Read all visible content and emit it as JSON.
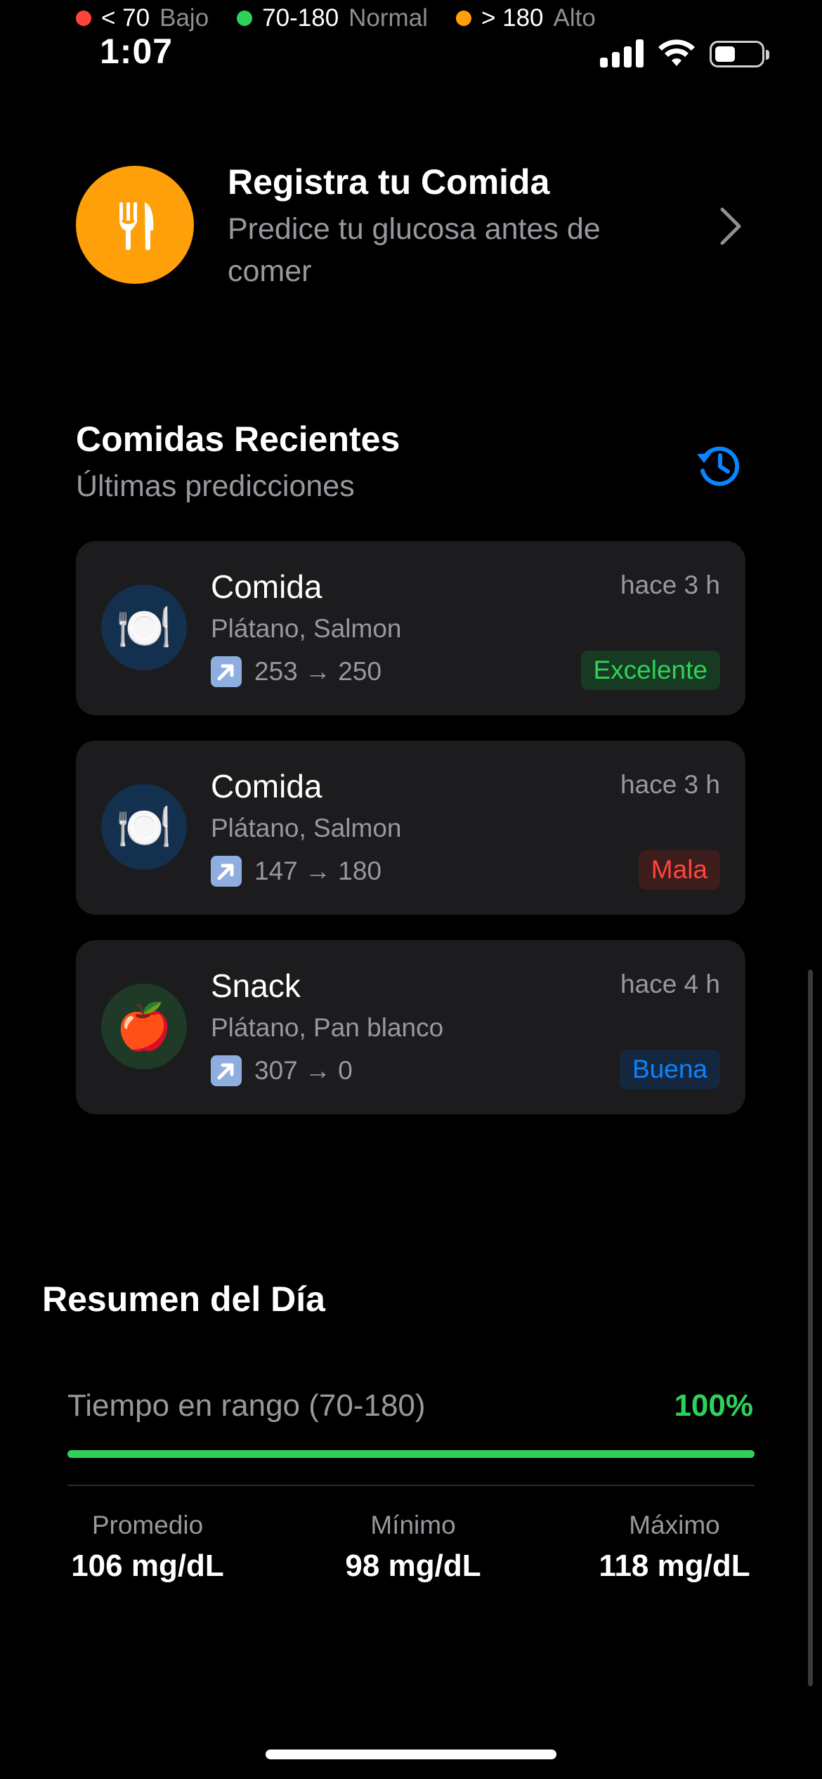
{
  "legend": [
    {
      "value": "< 70",
      "label": "Bajo",
      "color": "#ff453a"
    },
    {
      "value": "70-180",
      "label": "Normal",
      "color": "#30d158"
    },
    {
      "value": "> 180",
      "label": "Alto",
      "color": "#ff9f0a"
    }
  ],
  "status_bar": {
    "time": "1:07",
    "signal_icon": "cellular-signal-icon",
    "wifi_icon": "wifi-icon",
    "battery_icon": "battery-icon"
  },
  "register_meal": {
    "title": "Registra tu Comida",
    "subtitle": "Predice tu glucosa antes de comer",
    "icon": "fork-knife-icon",
    "accent": "#ff9f0a"
  },
  "recent_meals": {
    "title": "Comidas Recientes",
    "subtitle": "Últimas predicciones",
    "history_icon": "history-icon",
    "items": [
      {
        "title": "Comida",
        "time": "hace 3 h",
        "foods": "Plátano, Salmon",
        "trend": "253 → 250",
        "rating": "Excelente",
        "emoji": "🍽️",
        "avatar_color": "#14304f",
        "rating_color": "#30d158",
        "rating_bg": "#173a22"
      },
      {
        "title": "Comida",
        "time": "hace 3 h",
        "foods": "Plátano, Salmon",
        "trend": "147 → 180",
        "rating": "Mala",
        "emoji": "🍽️",
        "avatar_color": "#14304f",
        "rating_color": "#ff453a",
        "rating_bg": "#3d1c1c"
      },
      {
        "title": "Snack",
        "time": "hace 4 h",
        "foods": "Plátano, Pan blanco",
        "trend": "307 → 0",
        "rating": "Buena",
        "emoji": "🍎",
        "avatar_color": "#1f3a26",
        "rating_color": "#0a84ff",
        "rating_bg": "#14273f"
      }
    ]
  },
  "summary": {
    "title": "Resumen del Día",
    "time_in_range_label": "Tiempo en rango (70-180)",
    "time_in_range_value": "100%",
    "time_in_range_fraction": 1.0,
    "stats": [
      {
        "label": "Promedio",
        "value": "106 mg/dL"
      },
      {
        "label": "Mínimo",
        "value": "98 mg/dL"
      },
      {
        "label": "Máximo",
        "value": "118 mg/dL"
      }
    ]
  }
}
